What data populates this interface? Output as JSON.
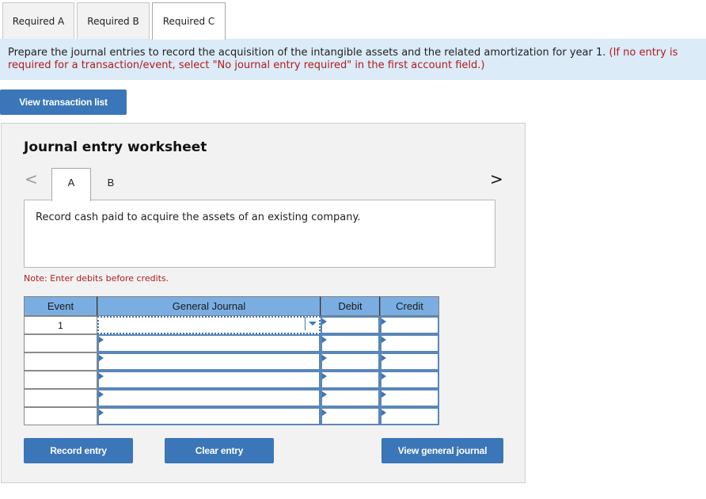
{
  "tabs": [
    {
      "label": "Required A",
      "active": false
    },
    {
      "label": "Required B",
      "active": false
    },
    {
      "label": "Required C",
      "active": true
    }
  ],
  "instructions": {
    "main": "Prepare the journal entries to record the acquisition of the intangible assets and the related amortization for year 1.",
    "note": "(If no entry is required for a transaction/event, select \"No journal entry required\" in the first account field.)"
  },
  "view_transaction_list_label": "View transaction list",
  "worksheet": {
    "title": "Journal entry worksheet",
    "nav_prev": "<",
    "nav_next": ">",
    "sub_tabs": [
      {
        "label": "A",
        "active": true
      },
      {
        "label": "B",
        "active": false
      }
    ],
    "description": "Record cash paid to acquire the assets of an existing company.",
    "note": "Note: Enter debits before credits.",
    "table": {
      "headers": [
        "Event",
        "General Journal",
        "Debit",
        "Credit"
      ],
      "rows": [
        {
          "event": "1",
          "account": "",
          "debit": "",
          "credit": ""
        },
        {
          "event": "",
          "account": "",
          "debit": "",
          "credit": ""
        },
        {
          "event": "",
          "account": "",
          "debit": "",
          "credit": ""
        },
        {
          "event": "",
          "account": "",
          "debit": "",
          "credit": ""
        },
        {
          "event": "",
          "account": "",
          "debit": "",
          "credit": ""
        },
        {
          "event": "",
          "account": "",
          "debit": "",
          "credit": ""
        }
      ]
    },
    "buttons": {
      "record": "Record entry",
      "clear": "Clear entry",
      "view_journal": "View general journal"
    }
  },
  "colors": {
    "accent": "#3b76b8",
    "banner": "#dbebf8",
    "header": "#7aaee3",
    "warning": "#b01c1c"
  }
}
